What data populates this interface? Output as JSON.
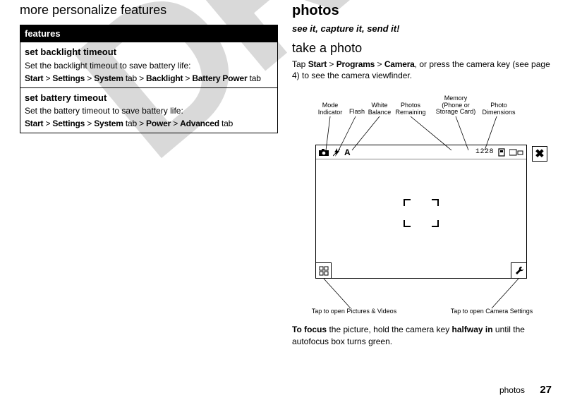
{
  "watermark": "DRAFT",
  "left": {
    "heading": "more personalize features",
    "table_header": "features",
    "rows": [
      {
        "title": "set backlight timeout",
        "desc": "Set the backlight timeout to save battery life:",
        "p1": "Start",
        "s1": " > ",
        "p2": "Settings",
        "s2": " > ",
        "p3": "System",
        "s3": " tab > ",
        "p4": "Backlight",
        "s4": " > ",
        "p5": "Battery Power",
        "s5": " tab"
      },
      {
        "title": "set battery timeout",
        "desc": "Set the battery timeout to save battery life:",
        "p1": "Start",
        "s1": " > ",
        "p2": "Settings",
        "s2": " > ",
        "p3": "System",
        "s3": " tab > ",
        "p4": "Power",
        "s4": " > ",
        "p5": "Advanced",
        "s5": " tab"
      }
    ]
  },
  "right": {
    "heading": "photos",
    "tagline": "see it, capture it, send it!",
    "subtitle": "take a photo",
    "intro_pre": "Tap ",
    "intro_b1": "Start",
    "intro_s1": " > ",
    "intro_b2": "Programs",
    "intro_s2": " > ",
    "intro_b3": "Camera",
    "intro_post": ", or press the camera key (see page 4) to see the camera viewfinder.",
    "labels": {
      "mode": "Mode\nIndicator",
      "flash": "Flash",
      "wb": "White\nBalance",
      "remaining": "Photos\nRemaining",
      "memory": "Memory\n(Phone or\nStorage Card)",
      "dims": "Photo\nDimensions",
      "open_pics": "Tap to open Pictures & Videos",
      "open_settings": "Tap to open Camera Settings"
    },
    "status": {
      "wb_letter": "A",
      "count": "1228"
    },
    "focus_pre": "To focus",
    "focus_mid": " the picture, hold the camera key ",
    "focus_b2": "halfway in",
    "focus_post": " until the autofocus box turns green."
  },
  "footer": {
    "section": "photos",
    "page": "27"
  }
}
